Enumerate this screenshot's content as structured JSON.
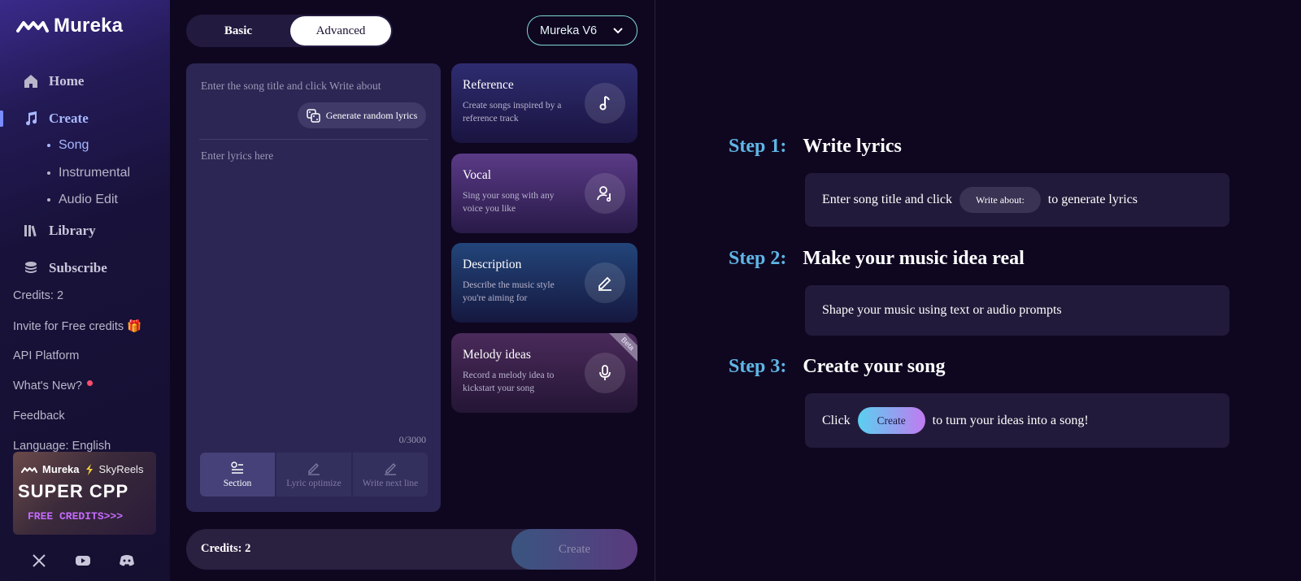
{
  "app": {
    "name": "Mureka"
  },
  "sidebar": {
    "nav": [
      {
        "label": "Home"
      },
      {
        "label": "Create"
      },
      {
        "label": "Library"
      },
      {
        "label": "Subscribe"
      }
    ],
    "create_sub": [
      {
        "label": "Song"
      },
      {
        "label": "Instrumental"
      },
      {
        "label": "Audio Edit"
      }
    ],
    "links": {
      "credits": "Credits: 2",
      "invite": "Invite for Free credits 🎁",
      "api": "API Platform",
      "whats_new": "What's New?",
      "feedback": "Feedback",
      "language": "Language: English"
    },
    "promo": {
      "brand1": "Mureka",
      "brand2": "SkyReels",
      "headline": "SUPER CPP",
      "sub": "FREE CREDITS>>>"
    }
  },
  "mode": {
    "basic": "Basic",
    "advanced": "Advanced"
  },
  "model": {
    "selected": "Mureka V6"
  },
  "lyrics": {
    "title_placeholder": "Enter the song title and click Write about",
    "gen_random": "Generate random lyrics",
    "placeholder": "Enter lyrics here",
    "count": "0/3000",
    "tools": [
      {
        "label": "Section"
      },
      {
        "label": "Lyric optimize"
      },
      {
        "label": "Write next line"
      }
    ]
  },
  "cards": [
    {
      "title": "Reference",
      "desc": "Create songs inspired by a reference track"
    },
    {
      "title": "Vocal",
      "desc": "Sing your song with any voice you like"
    },
    {
      "title": "Description",
      "desc": "Describe the music style you're aiming for"
    },
    {
      "title": "Melody ideas",
      "desc": "Record a melody idea to kickstart your song",
      "badge": "Beta"
    }
  ],
  "bottom": {
    "credits": "Credits: 2",
    "create": "Create"
  },
  "steps": [
    {
      "label": "Step 1:",
      "title": "Write lyrics",
      "pre": "Enter song title and click",
      "pill": "Write about:",
      "post": "to generate lyrics"
    },
    {
      "label": "Step 2:",
      "title": "Make your music idea real",
      "text": "Shape your music using text or audio prompts"
    },
    {
      "label": "Step 3:",
      "title": "Create your song",
      "pre": "Click",
      "pill": "Create",
      "post": "to turn your ideas into a song!"
    }
  ],
  "colors": {
    "accent": "#5fb6e6",
    "active_nav": "#a8b8ff",
    "model_border": "#7fd5d9"
  }
}
